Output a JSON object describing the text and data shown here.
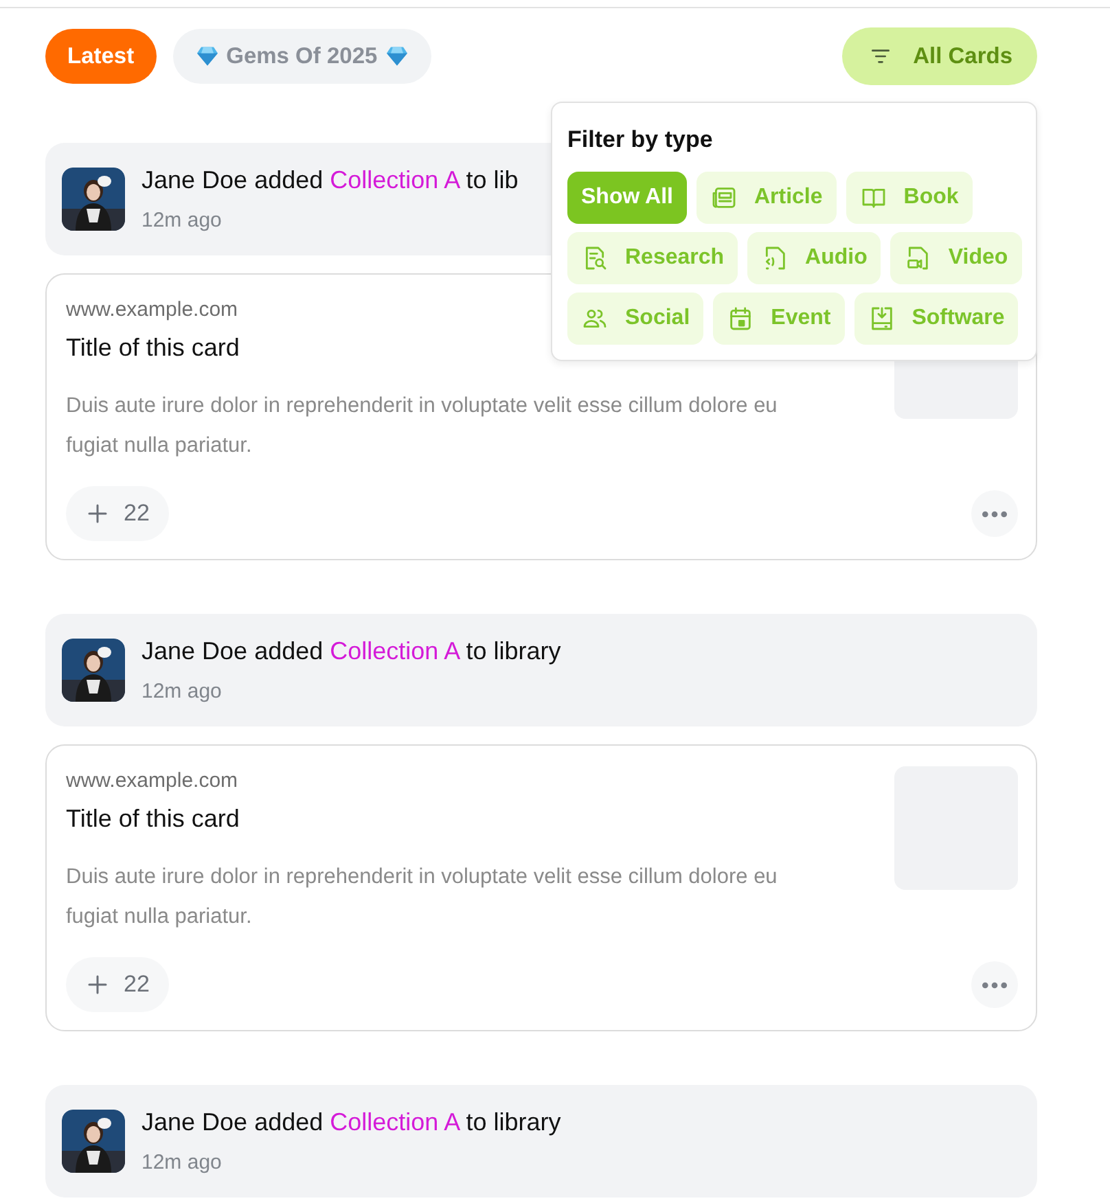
{
  "tabs": [
    {
      "label": "Latest",
      "kind": "plain",
      "selected": true
    },
    {
      "label": "Gems Of 2025",
      "kind": "gem",
      "selected": false
    }
  ],
  "filter_button": {
    "label": "All Cards",
    "expanded": true
  },
  "filter_menu": {
    "title": "Filter by type",
    "options": [
      {
        "label": "Show All",
        "kind": "all",
        "selected": true
      },
      {
        "label": "Article",
        "kind": "article",
        "selected": false
      },
      {
        "label": "Book",
        "kind": "book",
        "selected": false
      },
      {
        "label": "Research",
        "kind": "research",
        "selected": false
      },
      {
        "label": "Audio",
        "kind": "audio",
        "selected": false
      },
      {
        "label": "Video",
        "kind": "video",
        "selected": false
      },
      {
        "label": "Social",
        "kind": "social",
        "selected": false
      },
      {
        "label": "Event",
        "kind": "event",
        "selected": false
      },
      {
        "label": "Software",
        "kind": "software",
        "selected": false
      }
    ]
  },
  "feed": [
    {
      "actor": "Jane Doe",
      "verb": "added",
      "target": "Collection A",
      "rest": "to lib",
      "time": "12m ago",
      "card": {
        "domain": "www.example.com",
        "title": "Title of this card",
        "description": "Duis aute irure dolor in reprehenderit in voluptate velit esse cillum dolore eu fugiat nulla pariatur.",
        "count": "22"
      }
    },
    {
      "actor": "Jane Doe",
      "verb": "added",
      "target": "Collection A",
      "rest": "to library",
      "time": "12m ago",
      "card": {
        "domain": "www.example.com",
        "title": "Title of this card",
        "description": "Duis aute irure dolor in reprehenderit in voluptate velit esse cillum dolore eu fugiat nulla pariatur.",
        "count": "22"
      }
    },
    {
      "actor": "Jane Doe",
      "verb": "added",
      "target": "Collection A",
      "rest": "to library",
      "time": "12m ago"
    }
  ]
}
